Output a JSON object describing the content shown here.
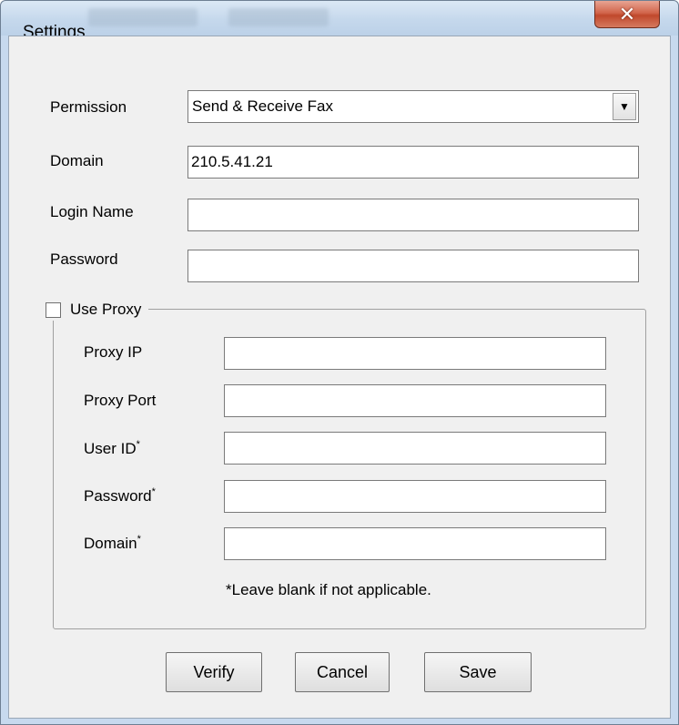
{
  "window": {
    "title": "Settings",
    "close_glyph": "✕"
  },
  "permission": {
    "label": "Permission",
    "value": "Send & Receive Fax",
    "arrow_icon": "▼"
  },
  "domain": {
    "label": "Domain",
    "value": "210.5.41.21"
  },
  "login_name": {
    "label": "Login Name",
    "value": ""
  },
  "password": {
    "label": "Password",
    "value": ""
  },
  "proxy": {
    "checkbox_label": "Use Proxy",
    "checked": false,
    "ip_label": "Proxy IP",
    "port_label": "Proxy Port",
    "user_id_label": "User ID",
    "password_label": "Password",
    "domain_label": "Domain",
    "required_mark": "*",
    "note": "*Leave blank if not applicable."
  },
  "buttons": {
    "verify": "Verify",
    "cancel": "Cancel",
    "save": "Save"
  }
}
